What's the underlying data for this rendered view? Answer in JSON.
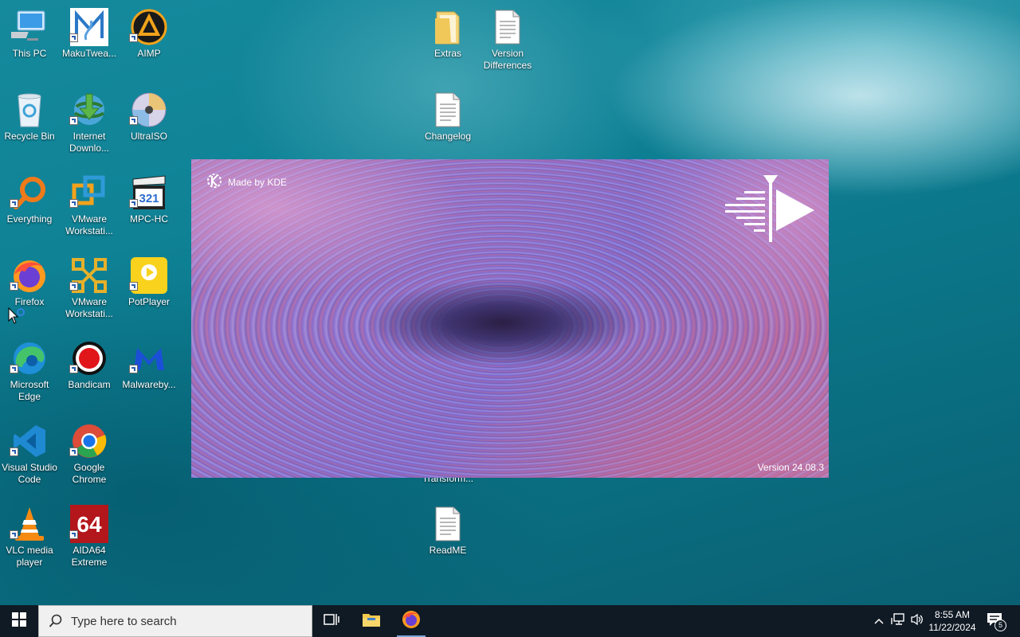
{
  "desktop_icons": {
    "this_pc": "This PC",
    "makutweaker": "MakuTwea...",
    "aimp": "AIMP",
    "extras": "Extras",
    "version_differences": "Version\nDifferences",
    "recycle_bin": "Recycle Bin",
    "idm": "Internet\nDownlo...",
    "ultraiso": "UltraISO",
    "changelog": "Changelog",
    "everything": "Everything",
    "vmware1": "VMware\nWorkstati...",
    "mpchc": "MPC-HC",
    "firefox": "Firefox",
    "vmware2": "VMware\nWorkstati...",
    "potplayer": "PotPlayer",
    "edge": "Microsoft\nEdge",
    "bandicam": "Bandicam",
    "malwarebytes": "Malwareby...",
    "vscode": "Visual Studio\nCode",
    "chrome": "Google\nChrome",
    "transform_partial": "Transform...",
    "vlc": "VLC media\nplayer",
    "aida64": "AIDA64\nExtreme",
    "readme": "ReadME"
  },
  "splash": {
    "made_by": "Made by KDE",
    "version": "Version 24.08.3"
  },
  "taskbar": {
    "search_placeholder": "Type here to search",
    "time": "8:55 AM",
    "date": "11/22/2024",
    "notification_count": "5"
  },
  "colors": {
    "taskbar_bg": "#101a24",
    "desktop_teal": "#0f8296",
    "splash_purple": "#8f6fc4"
  }
}
